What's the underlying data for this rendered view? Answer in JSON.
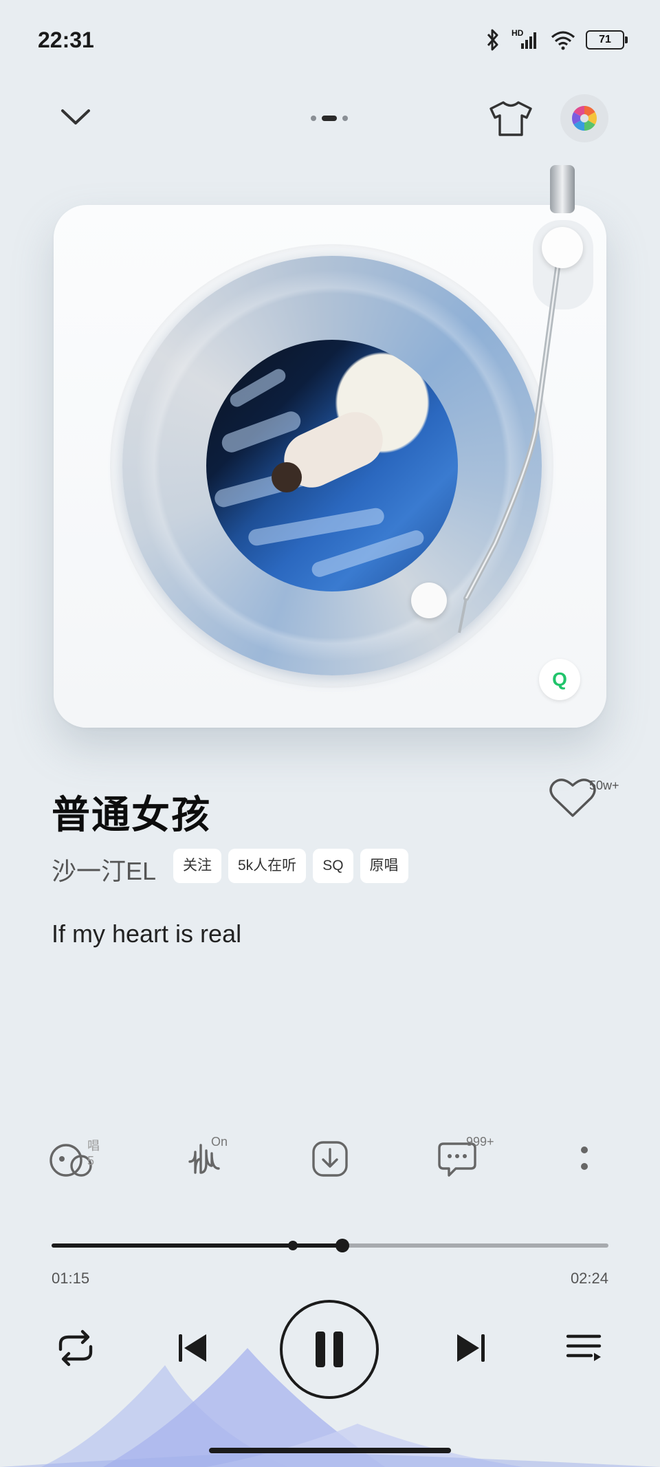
{
  "status_bar": {
    "time": "22:31",
    "network": "HD",
    "battery": "71"
  },
  "top_bar": {
    "pager_count": 3,
    "pager_active": 1
  },
  "player": {
    "badge_letter": "Q"
  },
  "song": {
    "title": "普通女孩",
    "artist": "沙一汀EL",
    "chips": [
      "关注",
      "5k人在听",
      "SQ",
      "原唱"
    ],
    "favorite_count": "50w+",
    "lyric": "If my heart is real"
  },
  "actions": {
    "sing_label": "唱 5",
    "effects_label": "On",
    "comments_label": "999+"
  },
  "progress": {
    "current": "01:15",
    "total": "02:24",
    "played_fraction": 0.522,
    "buffered_fraction": 0.433
  },
  "colors": {
    "background": "#e8edf1",
    "accent": "#1b1b1b",
    "qq_green": "#21c46b"
  }
}
